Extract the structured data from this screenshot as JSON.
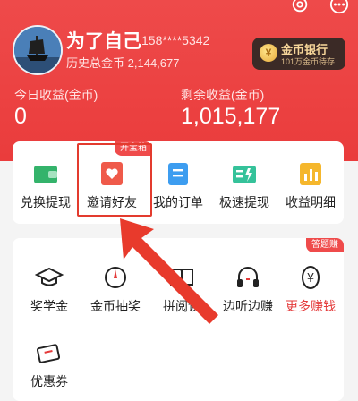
{
  "header": {
    "username": "为了自己",
    "phone": "158****5342",
    "history_label": "历史总金币",
    "history_value": "2,144,677",
    "bank": {
      "title": "金币银行",
      "subtitle": "101万金币待存"
    },
    "today_label": "今日收益(金币)",
    "today_value": "0",
    "remain_label": "剩余收益(金币)",
    "remain_value": "1,015,177",
    "icons": [
      "settings-icon",
      "more-icon"
    ]
  },
  "quick_actions": {
    "tag": "开宝箱",
    "items": [
      {
        "label": "兑换提现",
        "icon": "wallet-icon"
      },
      {
        "label": "邀请好友",
        "icon": "invite-heart-icon"
      },
      {
        "label": "我的订单",
        "icon": "order-icon"
      },
      {
        "label": "极速提现",
        "icon": "fast-withdraw-icon"
      },
      {
        "label": "收益明细",
        "icon": "earnings-chart-icon"
      }
    ]
  },
  "services": {
    "tag": "答题赚",
    "items": [
      {
        "label": "奖学金",
        "icon": "graduation-cap-icon"
      },
      {
        "label": "金币抽奖",
        "icon": "lottery-icon"
      },
      {
        "label": "拼阅读",
        "icon": "book-icon"
      },
      {
        "label": "边听边赚",
        "icon": "headphones-icon"
      },
      {
        "label": "更多赚钱",
        "icon": "yuan-coin-icon"
      },
      {
        "label": "优惠券",
        "icon": "coupon-icon"
      }
    ]
  },
  "colors": {
    "brand_red": "#ea3c3c",
    "bank_bg": "#3b2a26",
    "highlight": "#e33b2e"
  }
}
